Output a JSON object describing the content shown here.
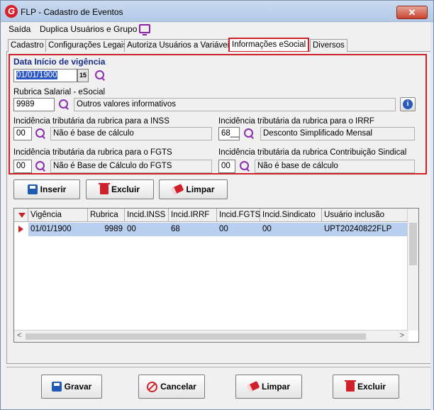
{
  "window": {
    "title": "FLP - Cadastro de Eventos",
    "close_label": "✕",
    "logo": "G"
  },
  "menu": {
    "items": [
      "Saída",
      "Duplica Usuários e Grupo"
    ]
  },
  "tabs": [
    "Cadastro",
    "Configurações Legais",
    "Autoriza Usuários a Variáveis",
    "Informações eSocial",
    "Diversos"
  ],
  "active_tab": "Informações eSocial",
  "form": {
    "date_label": "Data Início de vigência",
    "date_value": "01/01/1900",
    "calendar_btn": "15",
    "rubrica_label": "Rubrica Salarial - eSocial",
    "rubrica_code": "9989",
    "rubrica_desc": "Outros valores informativos",
    "inss_label": "Incidência tributária da rubrica para a INSS",
    "inss_code": "00",
    "inss_desc": "Não é base de cálculo",
    "irrf_label": "Incidência tributária da rubrica para o IRRF",
    "irrf_code": "68__",
    "irrf_desc": "Desconto Simplificado Mensal",
    "fgts_label": "Incidência tributária da rubrica para o FGTS",
    "fgts_code": "00",
    "fgts_desc": "Não é Base de Cálculo do FGTS",
    "sind_label": "Incidência tributária da rubrica Contribuição Sindical",
    "sind_code": "00",
    "sind_desc": "Não é base de cálculo"
  },
  "actions": {
    "insert": "Inserir",
    "delete": "Excluir",
    "clear": "Limpar"
  },
  "grid": {
    "columns": [
      "Vigência",
      "Rubrica",
      "Incid.INSS",
      "Incid.IRRF",
      "Incid.FGTS",
      "Incid.Sindicato",
      "Usuário inclusão"
    ],
    "rows": [
      {
        "vigencia": "01/01/1900",
        "rubrica": "9989",
        "inss": "00",
        "irrf": "68",
        "fgts": "00",
        "sindicato": "00",
        "usuario": "UPT20240822FLP"
      }
    ]
  },
  "footer": {
    "save": "Gravar",
    "cancel": "Cancelar",
    "clear": "Limpar",
    "delete": "Excluir"
  }
}
